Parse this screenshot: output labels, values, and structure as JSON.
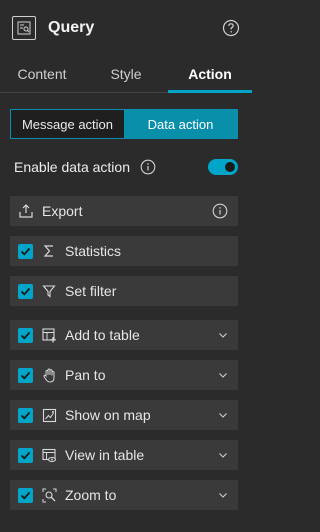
{
  "header": {
    "title": "Query",
    "app_icon": "query-widget-icon",
    "help_icon": "help-circle-icon"
  },
  "tabs": [
    {
      "label": "Content",
      "active": false
    },
    {
      "label": "Style",
      "active": false
    },
    {
      "label": "Action",
      "active": true
    }
  ],
  "segmented": [
    {
      "label": "Message action",
      "active": false
    },
    {
      "label": "Data action",
      "active": true
    }
  ],
  "enable_data_action": {
    "label": "Enable data action",
    "enabled": true
  },
  "export": {
    "label": "Export"
  },
  "actions": [
    {
      "label": "Statistics",
      "checked": true,
      "icon": "sigma-icon",
      "expandable": false
    },
    {
      "label": "Set filter",
      "checked": true,
      "icon": "filter-icon",
      "expandable": false
    },
    {
      "label": "Add to table",
      "checked": true,
      "icon": "add-table-icon",
      "expandable": true
    },
    {
      "label": "Pan to",
      "checked": true,
      "icon": "hand-icon",
      "expandable": true
    },
    {
      "label": "Show on map",
      "checked": true,
      "icon": "show-map-icon",
      "expandable": true
    },
    {
      "label": "View in table",
      "checked": true,
      "icon": "view-table-icon",
      "expandable": true
    },
    {
      "label": "Zoom to",
      "checked": true,
      "icon": "zoom-to-icon",
      "expandable": true
    }
  ],
  "colors": {
    "accent": "#00a5c8",
    "background": "#2b2b2b",
    "row": "#3a3a3a"
  }
}
